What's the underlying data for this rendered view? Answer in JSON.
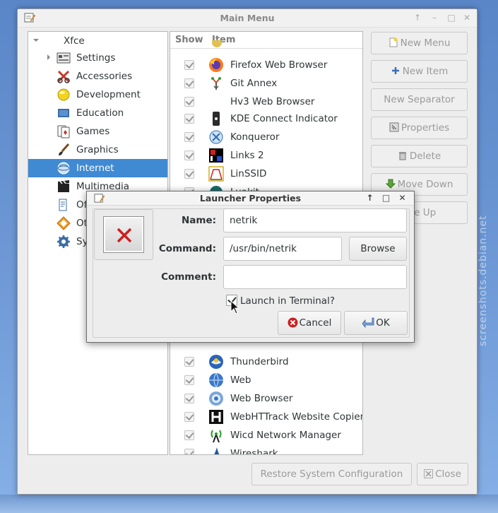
{
  "window": {
    "title": "Main Menu"
  },
  "categories": {
    "root_label": "Xfce",
    "items": [
      {
        "label": "Settings",
        "icon": "settings-icon"
      },
      {
        "label": "Accessories",
        "icon": "accessories-icon"
      },
      {
        "label": "Development",
        "icon": "development-icon"
      },
      {
        "label": "Education",
        "icon": "education-icon"
      },
      {
        "label": "Games",
        "icon": "games-icon"
      },
      {
        "label": "Graphics",
        "icon": "graphics-icon"
      },
      {
        "label": "Internet",
        "icon": "internet-icon",
        "selected": true
      },
      {
        "label": "Multimedia",
        "icon": "multimedia-icon"
      },
      {
        "label": "Of",
        "icon": "office-icon"
      },
      {
        "label": "Ot",
        "icon": "other-icon"
      },
      {
        "label": "Sy",
        "icon": "system-icon"
      }
    ]
  },
  "items_list": {
    "header_show": "Show",
    "header_item": "Item",
    "rows_top": [
      {
        "label": "Firefox Web Browser",
        "icon": "firefox-icon"
      },
      {
        "label": "Git Annex",
        "icon": "git-annex-icon"
      },
      {
        "label": "Hv3 Web Browser",
        "icon": ""
      },
      {
        "label": "KDE Connect Indicator",
        "icon": "kdeconnect-icon"
      },
      {
        "label": "Konqueror",
        "icon": "konqueror-icon"
      },
      {
        "label": "Links 2",
        "icon": "links-icon"
      },
      {
        "label": "LinSSID",
        "icon": "linssid-icon"
      },
      {
        "label": "Luakit",
        "icon": "luakit-icon"
      }
    ],
    "rows_bottom": [
      {
        "label": "Thunderbird",
        "icon": "thunderbird-icon"
      },
      {
        "label": "Web",
        "icon": "web-icon"
      },
      {
        "label": "Web Browser",
        "icon": "web-browser-icon"
      },
      {
        "label": "WebHTTrack Website Copier",
        "icon": "webhttrack-icon"
      },
      {
        "label": "Wicd Network Manager",
        "icon": "wicd-icon"
      },
      {
        "label": "Wireshark",
        "icon": "wireshark-icon"
      }
    ]
  },
  "side_buttons": {
    "new_menu": "New Menu",
    "new_item": "New Item",
    "new_separator": "New Separator",
    "properties": "Properties",
    "delete": "Delete",
    "move_down": "Move Down",
    "move_up": "ove Up"
  },
  "bottom_buttons": {
    "restore": "Restore System Configuration",
    "close": "Close"
  },
  "dialog": {
    "title": "Launcher Properties",
    "name_label": "Name:",
    "name_value": "netrik",
    "command_label": "Command:",
    "command_value": "/usr/bin/netrik",
    "browse": "Browse",
    "comment_label": "Comment:",
    "comment_value": "",
    "terminal_label": "Launch in Terminal?",
    "terminal_checked": true,
    "cancel": "Cancel",
    "ok": "OK"
  },
  "watermark": "screenshots.debian.net",
  "colors": {
    "selection": "#3f8ad2",
    "desktop": "#6f9ad6",
    "cancel_icon": "#cc1f1f"
  }
}
